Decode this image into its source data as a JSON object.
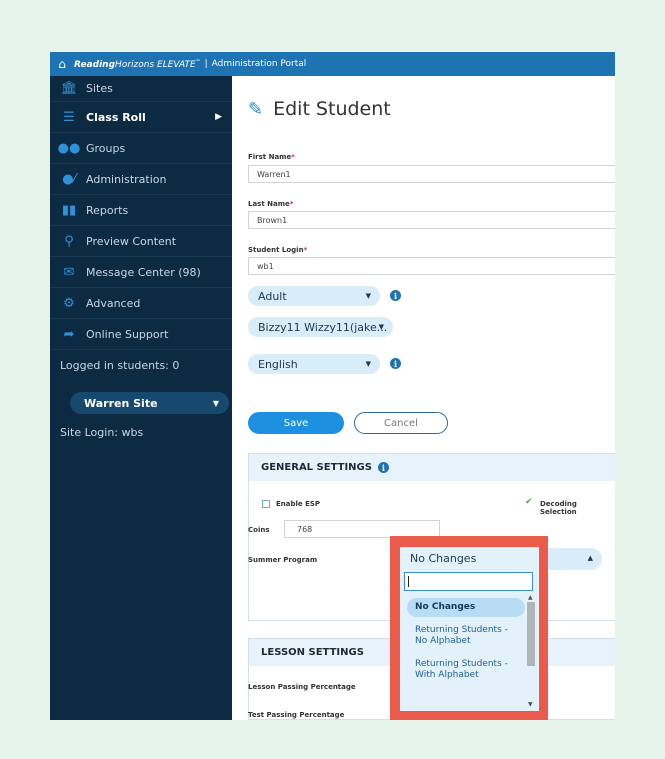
{
  "topbar": {
    "brand_bold": "Reading",
    "brand_rest": "Horizons ELEVATE",
    "tm": "™",
    "separator": "|",
    "portal": "Administration Portal"
  },
  "sidebar": {
    "items": [
      {
        "label": "Sites",
        "icon": "institution-icon"
      },
      {
        "label": "Class Roll",
        "icon": "list-icon"
      },
      {
        "label": "Groups",
        "icon": "groups-icon"
      },
      {
        "label": "Administration",
        "icon": "admin-icon"
      },
      {
        "label": "Reports",
        "icon": "chart-icon"
      },
      {
        "label": "Preview Content",
        "icon": "search-icon"
      },
      {
        "label": "Message Center (98)",
        "icon": "message-icon"
      },
      {
        "label": "Advanced",
        "icon": "gear-icon"
      },
      {
        "label": "Online Support",
        "icon": "share-icon"
      }
    ],
    "logged_in": "Logged in students: 0",
    "site_select": "Warren Site",
    "site_login": "Site Login: wbs"
  },
  "main": {
    "title": "Edit Student",
    "first_name_label": "First Name",
    "first_name_value": "Warren1",
    "last_name_label": "Last Name",
    "last_name_value": "Brown1",
    "login_label": "Student Login",
    "login_value": "wb1",
    "required_mark": "*",
    "level_select": "Adult",
    "teacher_select": "Bizzy11 Wizzy11(jake...",
    "language_select": "English",
    "save": "Save",
    "cancel": "Cancel"
  },
  "general": {
    "heading": "GENERAL SETTINGS",
    "enable_esp": "Enable ESP",
    "decoding": "Decoding Selection",
    "coins_label": "Coins",
    "coins_value": "768",
    "summer_label": "Summer Program"
  },
  "lesson": {
    "heading": "LESSON SETTINGS",
    "lesson_pass": "Lesson Passing Percentage",
    "test_pass": "Test Passing Percentage"
  },
  "dropdown": {
    "current": "No Changes",
    "search_value": "",
    "options": [
      {
        "label": "No Changes",
        "selected": true
      },
      {
        "label": "Returning Students - No Alphabet",
        "selected": false
      },
      {
        "label": "Returning Students - With Alphabet",
        "selected": false
      }
    ]
  },
  "colors": {
    "topbar": "#1e74b3",
    "sidebar": "#0d2a43",
    "accent": "#1e90e0",
    "highlight_border": "#ea5b4b",
    "page_bg": "#e6f4ec"
  }
}
